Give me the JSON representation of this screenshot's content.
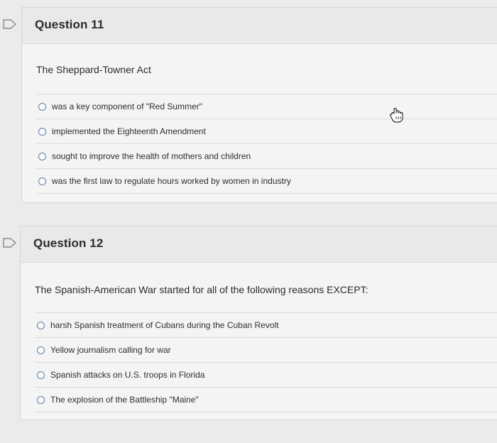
{
  "questions": [
    {
      "title": "Question 11",
      "stem": "The Sheppard-Towner Act",
      "answers": [
        "was a key component of \"Red Summer\"",
        "implemented the Eighteenth Amendment",
        "sought to improve the health of mothers and children",
        "was the first law to regulate hours worked by women in industry"
      ]
    },
    {
      "title": "Question 12",
      "stem": "The Spanish-American War started for all of the following reasons EXCEPT:",
      "answers": [
        "harsh Spanish treatment of Cubans during the Cuban Revolt",
        "Yellow journalism calling for war",
        "Spanish attacks on U.S. troops in Florida",
        "The explosion of the Battleship \"Maine\""
      ]
    }
  ],
  "icons": {
    "question_flag": "flag-icon",
    "cursor": "hand-pointer-icon"
  },
  "colors": {
    "background": "#ebebeb",
    "card": "#f4f4f4",
    "header": "#e9e9e9",
    "radio_border": "#5b7fa8"
  }
}
